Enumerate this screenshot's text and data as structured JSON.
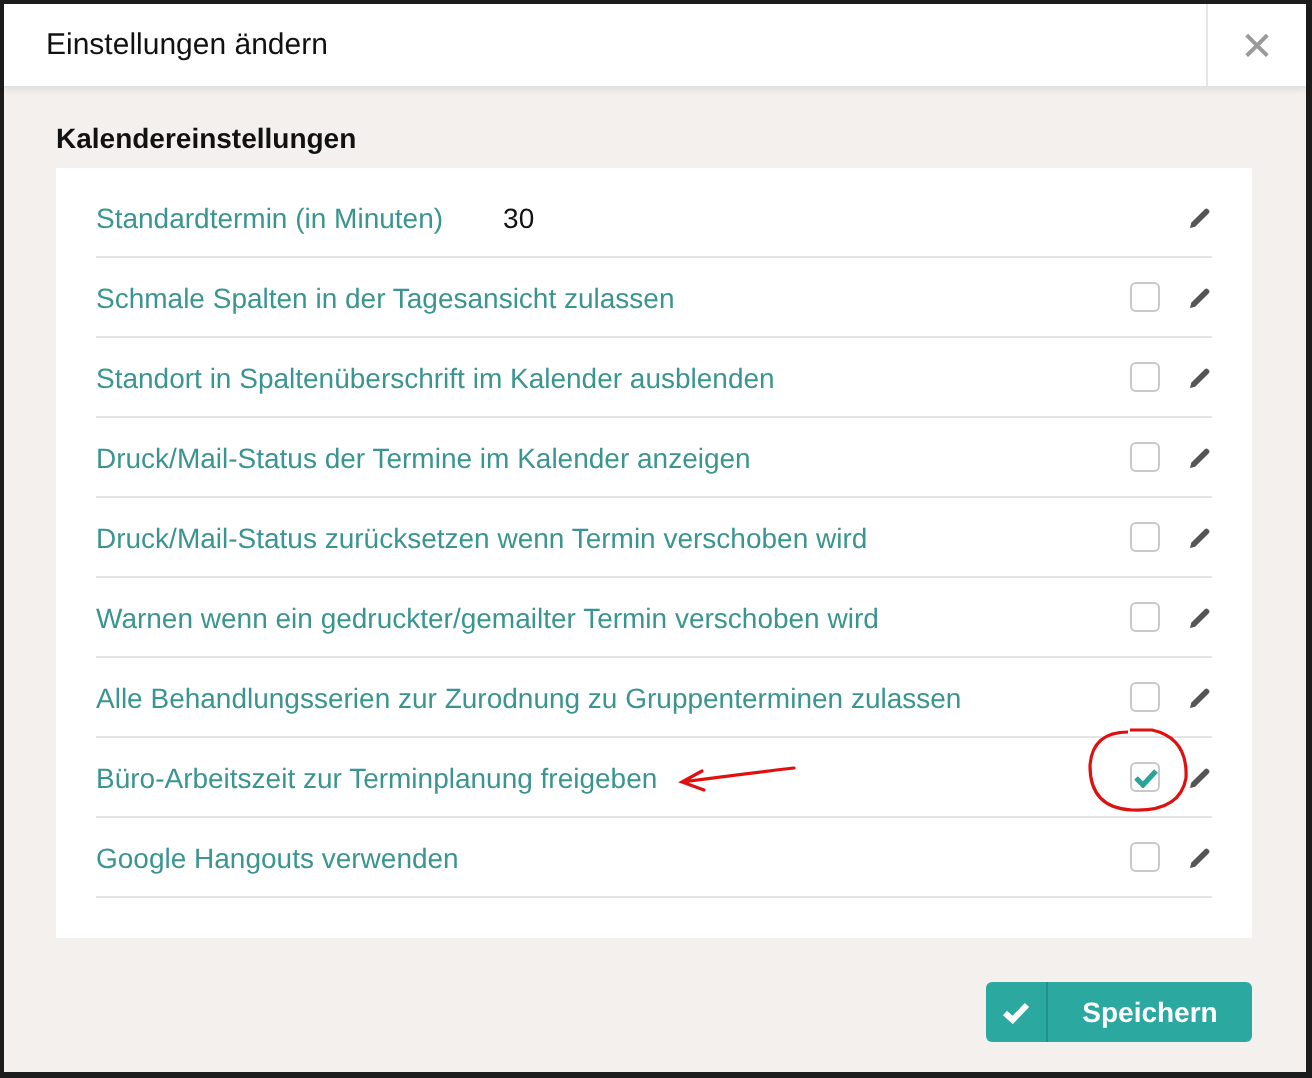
{
  "dialog": {
    "title": "Einstellungen ändern",
    "close_icon": "✕"
  },
  "section": {
    "title": "Kalendereinstellungen"
  },
  "settings": [
    {
      "kind": "number",
      "label": "Standardtermin (in Minuten)",
      "value": "30"
    },
    {
      "kind": "checkbox",
      "label": "Schmale Spalten in der Tagesansicht zulassen",
      "checked": false
    },
    {
      "kind": "checkbox",
      "label": "Standort in Spaltenüberschrift im Kalender ausblenden",
      "checked": false
    },
    {
      "kind": "checkbox",
      "label": "Druck/Mail-Status der Termine im Kalender anzeigen",
      "checked": false
    },
    {
      "kind": "checkbox",
      "label": "Druck/Mail-Status zurücksetzen wenn Termin verschoben wird",
      "checked": false
    },
    {
      "kind": "checkbox",
      "label": "Warnen wenn ein gedruckter/gemailter Termin verschoben wird",
      "checked": false
    },
    {
      "kind": "checkbox",
      "label": "Alle Behandlungsserien zur Zurodnung zu Gruppenterminen zulassen",
      "checked": false
    },
    {
      "kind": "checkbox",
      "label": "Büro-Arbeitszeit zur Terminplanung freigeben",
      "checked": true,
      "highlighted": true
    },
    {
      "kind": "checkbox",
      "label": "Google Hangouts verwenden",
      "checked": false
    }
  ],
  "save_button": {
    "label": "Speichern"
  }
}
